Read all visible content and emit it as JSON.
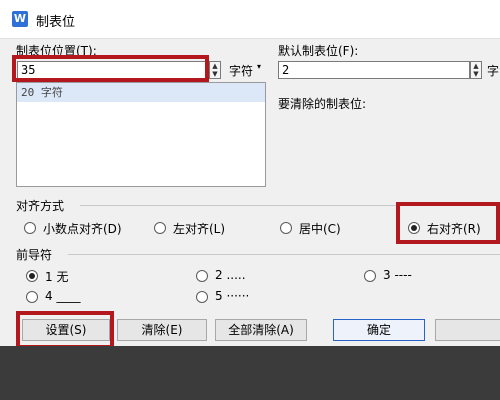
{
  "window": {
    "title": "制表位",
    "icon_letter": "W"
  },
  "tab_position": {
    "label": "制表位位置(T):",
    "value": "35",
    "unit": "字符",
    "list": [
      "20 字符"
    ]
  },
  "default_tab": {
    "label": "默认制表位(F):",
    "value": "2",
    "unit": "字"
  },
  "clear_label": "要清除的制表位:",
  "alignment": {
    "label": "对齐方式",
    "options": [
      "小数点对齐(D)",
      "左对齐(L)",
      "居中(C)",
      "右对齐(R)"
    ],
    "selected": "右对齐(R)"
  },
  "leader": {
    "label": "前导符",
    "options": [
      "1 无",
      "2 .....",
      "3 ----",
      "4 ____",
      "5 ······"
    ],
    "selected": "1 无"
  },
  "buttons": {
    "set": "设置(S)",
    "clear": "清除(E)",
    "clear_all": "全部清除(A)",
    "ok": "确定"
  },
  "colors": {
    "highlight": "#b3181e",
    "accent": "#2a63c7"
  }
}
